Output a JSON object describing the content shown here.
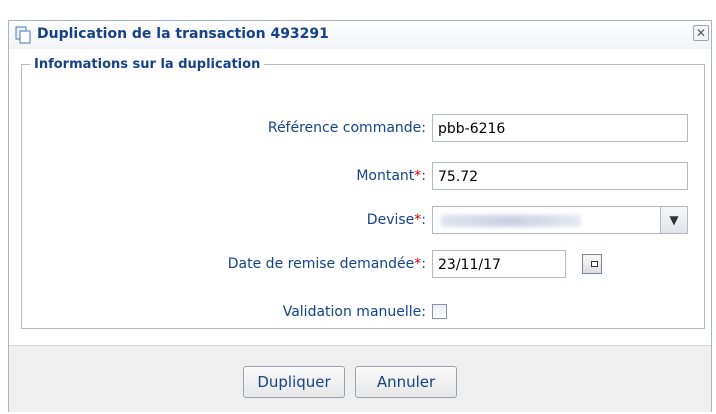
{
  "dialog": {
    "title": "Duplication de la transaction 493291",
    "close_glyph": "✕"
  },
  "form": {
    "section_title": "Informations sur la duplication",
    "fields": {
      "reference": {
        "label": "Référence commande:",
        "value": "pbb-6216"
      },
      "amount": {
        "label": "Montant",
        "required_mark": "*",
        "suffix": ":",
        "value": "75.72"
      },
      "currency": {
        "label": "Devise",
        "required_mark": "*",
        "suffix": ":",
        "value_redacted": true
      },
      "date": {
        "label": "Date de remise demandée",
        "required_mark": "*",
        "suffix": ":",
        "value": "23/11/17"
      },
      "manual": {
        "label": "Validation manuelle:",
        "checked": false
      }
    }
  },
  "footer": {
    "duplicate_label": "Dupliquer",
    "cancel_label": "Annuler"
  },
  "colors": {
    "title_blue": "#15428b",
    "required_red": "#cc0000",
    "footer_bg": "#efefef"
  },
  "icons": {
    "title": "duplicate-document-icon",
    "close": "close-icon",
    "select": "chevron-down-icon",
    "calendar": "calendar-icon"
  }
}
